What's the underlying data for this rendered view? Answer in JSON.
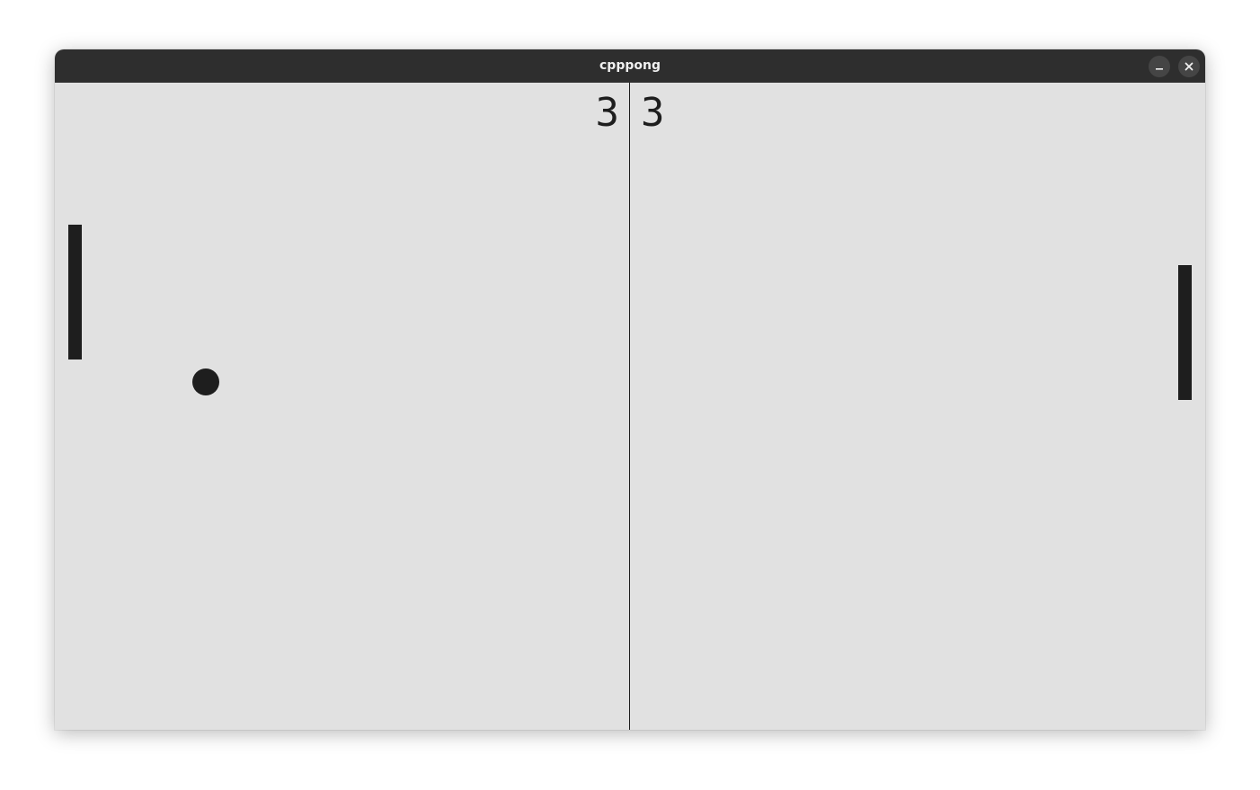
{
  "window": {
    "title": "cpppong"
  },
  "controls": {
    "minimize_icon": "minimize-icon",
    "close_icon": "close-icon"
  },
  "scores": {
    "left": "3",
    "right": "3"
  },
  "colors": {
    "titlebar": "#2e2e2e",
    "field": "#e1e1e1",
    "foreground": "#1e1e1e"
  }
}
